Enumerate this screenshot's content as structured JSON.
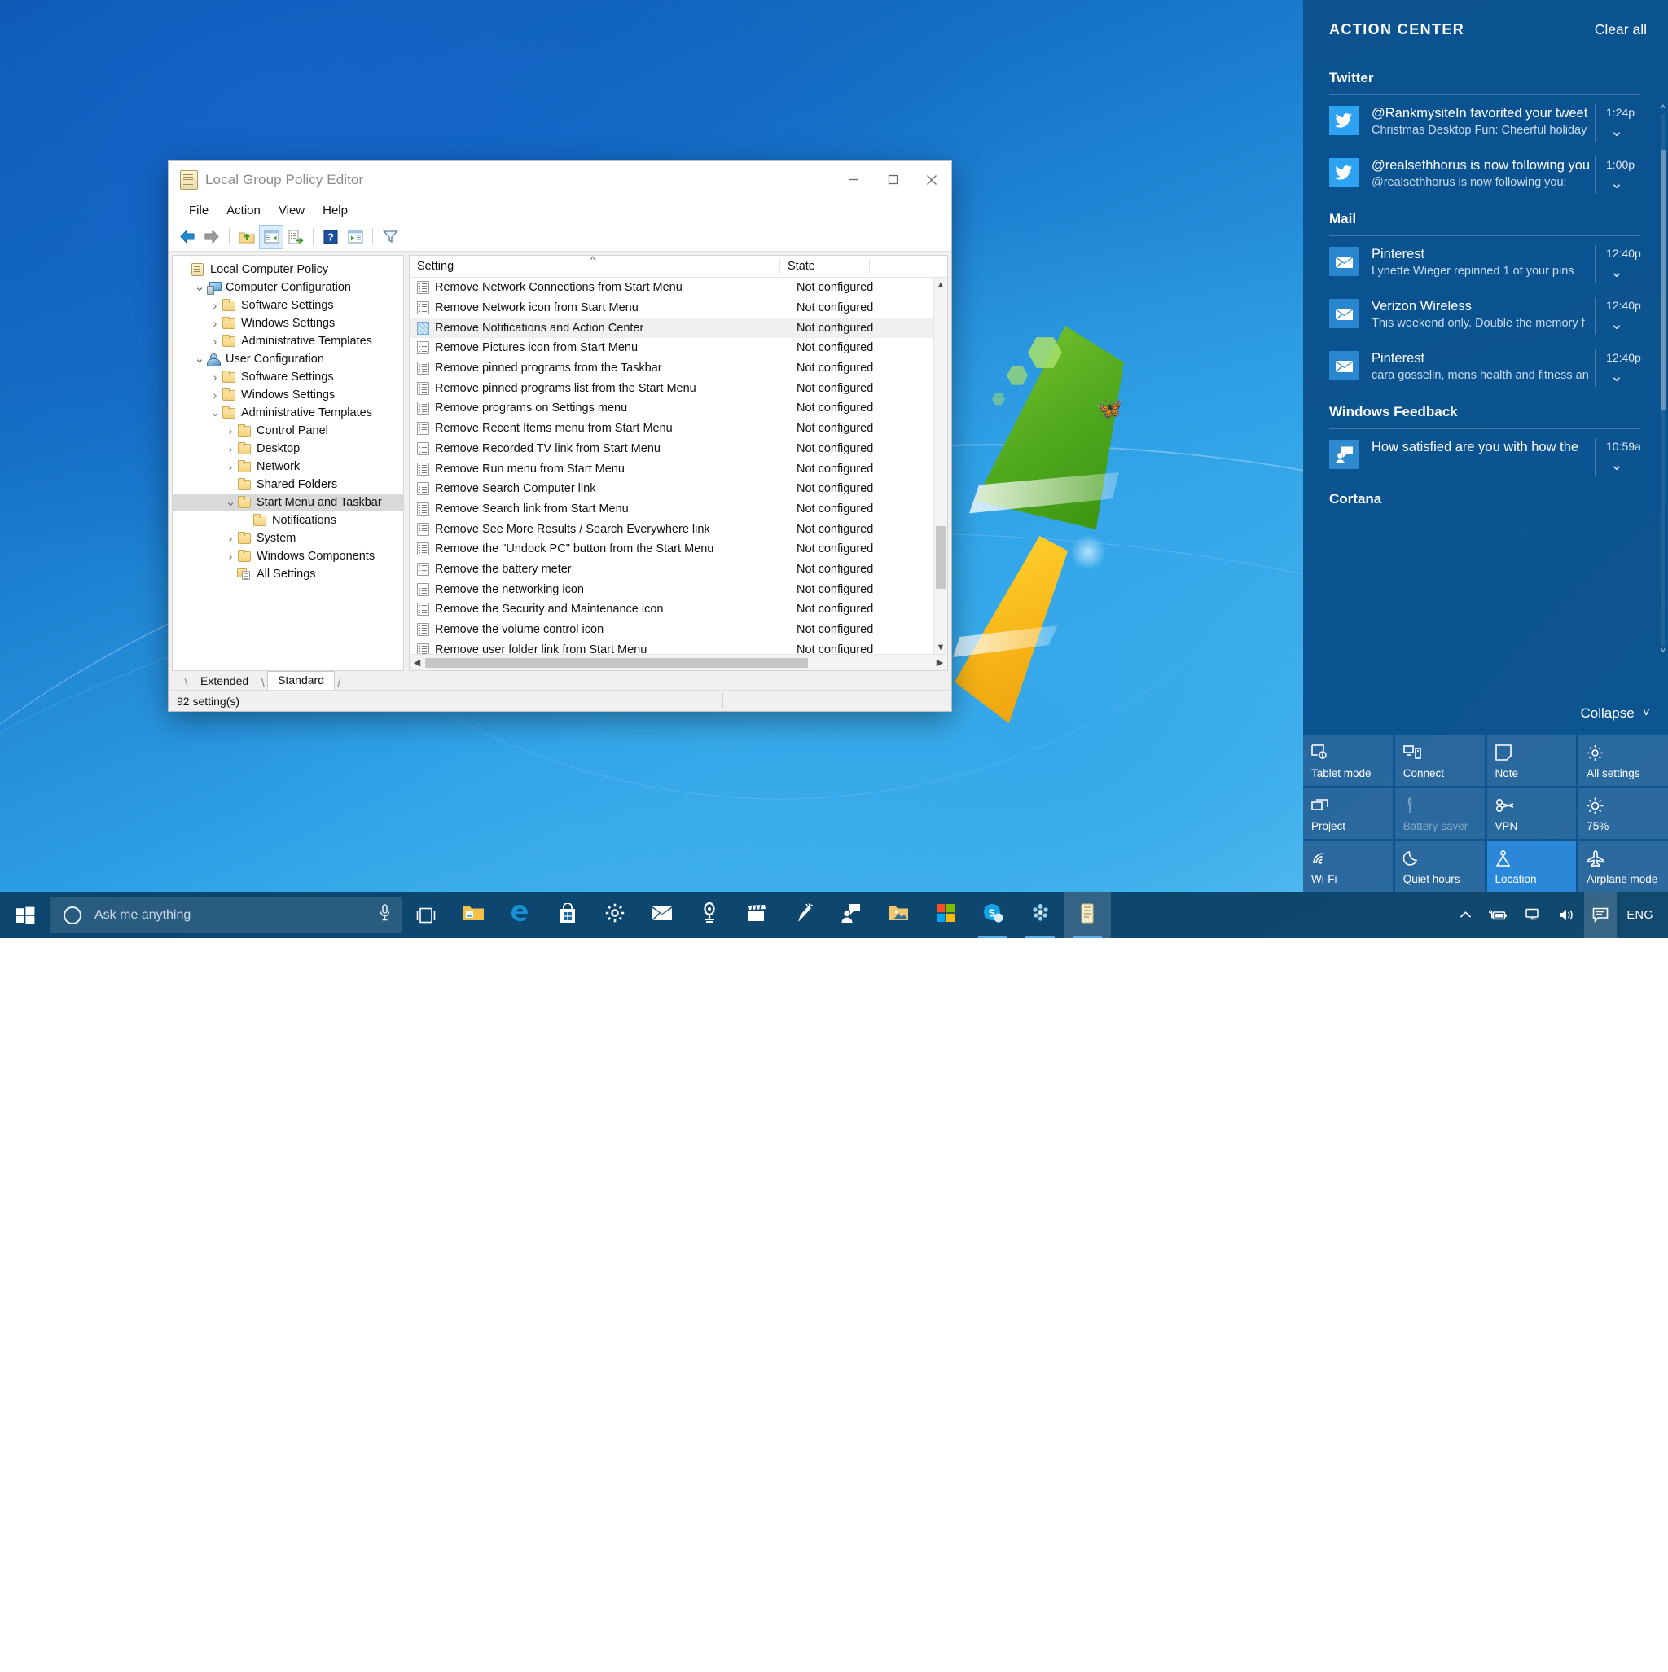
{
  "window": {
    "title": "Local Group Policy Editor",
    "title_icon": "policy-scroll-icon",
    "controls": {
      "minimize": "minimize-icon",
      "maximize": "maximize-icon",
      "close": "close-icon"
    },
    "menu": [
      "File",
      "Action",
      "View",
      "Help"
    ],
    "toolbar": [
      {
        "name": "back-button",
        "icon": "arrow-left-icon",
        "active": false
      },
      {
        "name": "forward-button",
        "icon": "arrow-right-icon",
        "active": false
      },
      {
        "name": "up-one-level-button",
        "icon": "folder-up-icon",
        "active": false
      },
      {
        "name": "show-hide-console-tree-button",
        "icon": "console-tree-icon",
        "active": true
      },
      {
        "name": "export-list-button",
        "icon": "export-list-icon",
        "active": false
      },
      {
        "name": "help-button",
        "icon": "help-question-icon",
        "active": false
      },
      {
        "name": "show-hide-action-pane-button",
        "icon": "action-pane-icon",
        "active": false
      },
      {
        "name": "filter-button",
        "icon": "funnel-filter-icon",
        "active": false
      }
    ],
    "tree": [
      {
        "label": "Local Computer Policy",
        "indent": 0,
        "chevron": "none",
        "icon": "policy-scroll-icon",
        "selected": false
      },
      {
        "label": "Computer Configuration",
        "indent": 1,
        "chevron": "down",
        "icon": "computer-icon",
        "selected": false
      },
      {
        "label": "Software Settings",
        "indent": 2,
        "chevron": "right",
        "icon": "folder-icon",
        "selected": false
      },
      {
        "label": "Windows Settings",
        "indent": 2,
        "chevron": "right",
        "icon": "folder-icon",
        "selected": false
      },
      {
        "label": "Administrative Templates",
        "indent": 2,
        "chevron": "right",
        "icon": "folder-icon",
        "selected": false
      },
      {
        "label": "User Configuration",
        "indent": 1,
        "chevron": "down",
        "icon": "user-icon",
        "selected": false
      },
      {
        "label": "Software Settings",
        "indent": 2,
        "chevron": "right",
        "icon": "folder-icon",
        "selected": false
      },
      {
        "label": "Windows Settings",
        "indent": 2,
        "chevron": "right",
        "icon": "folder-icon",
        "selected": false
      },
      {
        "label": "Administrative Templates",
        "indent": 2,
        "chevron": "down",
        "icon": "folder-icon",
        "selected": false
      },
      {
        "label": "Control Panel",
        "indent": 3,
        "chevron": "right",
        "icon": "folder-icon",
        "selected": false
      },
      {
        "label": "Desktop",
        "indent": 3,
        "chevron": "right",
        "icon": "folder-icon",
        "selected": false
      },
      {
        "label": "Network",
        "indent": 3,
        "chevron": "right",
        "icon": "folder-icon",
        "selected": false
      },
      {
        "label": "Shared Folders",
        "indent": 3,
        "chevron": "none",
        "icon": "folder-icon",
        "selected": false
      },
      {
        "label": "Start Menu and Taskbar",
        "indent": 3,
        "chevron": "down",
        "icon": "folder-icon",
        "selected": true
      },
      {
        "label": "Notifications",
        "indent": 4,
        "chevron": "none",
        "icon": "folder-icon",
        "selected": false
      },
      {
        "label": "System",
        "indent": 3,
        "chevron": "right",
        "icon": "folder-icon",
        "selected": false
      },
      {
        "label": "Windows Components",
        "indent": 3,
        "chevron": "right",
        "icon": "folder-icon",
        "selected": false
      },
      {
        "label": "All Settings",
        "indent": 3,
        "chevron": "none",
        "icon": "all-settings-icon",
        "selected": false
      }
    ],
    "list": {
      "columns": [
        "Setting",
        "State"
      ],
      "sort_indicator": "ascending-caret-icon",
      "rows": [
        {
          "setting": "Remove Network Connections from Start Menu",
          "state": "Not configured",
          "selected": false
        },
        {
          "setting": "Remove Network icon from Start Menu",
          "state": "Not configured",
          "selected": false
        },
        {
          "setting": "Remove Notifications and Action Center",
          "state": "Not configured",
          "selected": true
        },
        {
          "setting": "Remove Pictures icon from Start Menu",
          "state": "Not configured",
          "selected": false
        },
        {
          "setting": "Remove pinned programs from the Taskbar",
          "state": "Not configured",
          "selected": false
        },
        {
          "setting": "Remove pinned programs list from the Start Menu",
          "state": "Not configured",
          "selected": false
        },
        {
          "setting": "Remove programs on Settings menu",
          "state": "Not configured",
          "selected": false
        },
        {
          "setting": "Remove Recent Items menu from Start Menu",
          "state": "Not configured",
          "selected": false
        },
        {
          "setting": "Remove Recorded TV link from Start Menu",
          "state": "Not configured",
          "selected": false
        },
        {
          "setting": "Remove Run menu from Start Menu",
          "state": "Not configured",
          "selected": false
        },
        {
          "setting": "Remove Search Computer link",
          "state": "Not configured",
          "selected": false
        },
        {
          "setting": "Remove Search link from Start Menu",
          "state": "Not configured",
          "selected": false
        },
        {
          "setting": "Remove See More Results / Search Everywhere link",
          "state": "Not configured",
          "selected": false
        },
        {
          "setting": "Remove the \"Undock PC\" button from the Start Menu",
          "state": "Not configured",
          "selected": false
        },
        {
          "setting": "Remove the battery meter",
          "state": "Not configured",
          "selected": false
        },
        {
          "setting": "Remove the networking icon",
          "state": "Not configured",
          "selected": false
        },
        {
          "setting": "Remove the Security and Maintenance icon",
          "state": "Not configured",
          "selected": false
        },
        {
          "setting": "Remove the volume control icon",
          "state": "Not configured",
          "selected": false
        },
        {
          "setting": "Remove user folder link from Start Menu",
          "state": "Not configured",
          "selected": false
        }
      ]
    },
    "tabs": [
      {
        "label": "Extended",
        "active": false
      },
      {
        "label": "Standard",
        "active": true
      }
    ],
    "statusbar": {
      "count": "92 setting(s)",
      "cell2": "",
      "cell3": ""
    }
  },
  "action_center": {
    "title": "ACTION CENTER",
    "clear_all": "Clear all",
    "collapse": "Collapse",
    "groups": [
      {
        "name": "Twitter",
        "items": [
          {
            "icon": "twitter-icon",
            "title": "@RankmysiteIn favorited your tweet",
            "body": "Christmas Desktop Fun: Cheerful holiday",
            "time": "1:24p"
          },
          {
            "icon": "twitter-icon",
            "title": "@realsethhorus is now following you",
            "body": "@realsethhorus is now following you!",
            "time": "1:00p"
          }
        ]
      },
      {
        "name": "Mail",
        "items": [
          {
            "icon": "mail-icon",
            "title": "Pinterest",
            "body": "Lynette Wieger repinned 1 of your pins",
            "time": "12:40p"
          },
          {
            "icon": "mail-icon",
            "title": "Verizon Wireless",
            "body": "This weekend only. Double the memory f",
            "time": "12:40p"
          },
          {
            "icon": "mail-icon",
            "title": "Pinterest",
            "body": "cara gosselin, mens health and fitness an",
            "time": "12:40p"
          }
        ]
      },
      {
        "name": "Windows Feedback",
        "items": [
          {
            "icon": "feedback-icon",
            "title": "How satisfied are you with how the",
            "body": "",
            "time": "10:59a"
          }
        ]
      },
      {
        "name": "Cortana",
        "items": []
      }
    ],
    "tiles": [
      {
        "label": "Tablet mode",
        "icon": "tablet-mode-icon",
        "state": "off"
      },
      {
        "label": "Connect",
        "icon": "connect-icon",
        "state": "off"
      },
      {
        "label": "Note",
        "icon": "note-icon",
        "state": "off"
      },
      {
        "label": "All settings",
        "icon": "gear-icon",
        "state": "off"
      },
      {
        "label": "Project",
        "icon": "project-icon",
        "state": "off"
      },
      {
        "label": "Battery saver",
        "icon": "battery-saver-icon",
        "state": "disabled"
      },
      {
        "label": "VPN",
        "icon": "vpn-icon",
        "state": "off"
      },
      {
        "label": "75%",
        "icon": "brightness-icon",
        "state": "off"
      },
      {
        "label": "Wi-Fi",
        "icon": "wifi-icon",
        "state": "off"
      },
      {
        "label": "Quiet hours",
        "icon": "moon-icon",
        "state": "off"
      },
      {
        "label": "Location",
        "icon": "location-icon",
        "state": "on"
      },
      {
        "label": "Airplane mode",
        "icon": "airplane-icon",
        "state": "off"
      }
    ]
  },
  "taskbar": {
    "start": "windows-logo-icon",
    "search_placeholder": "Ask me anything",
    "cortana_icon": "cortana-circle-icon",
    "mic_icon": "microphone-icon",
    "taskview_icon": "task-view-icon",
    "apps": [
      {
        "name": "file-explorer",
        "icon": "folder-icon",
        "running": false,
        "active": false
      },
      {
        "name": "microsoft-edge",
        "icon": "edge-icon",
        "running": false,
        "active": false
      },
      {
        "name": "store",
        "icon": "store-bag-icon",
        "running": false,
        "active": false
      },
      {
        "name": "settings",
        "icon": "gear-icon",
        "running": false,
        "active": false
      },
      {
        "name": "mail",
        "icon": "envelope-icon",
        "running": false,
        "active": false
      },
      {
        "name": "maps",
        "icon": "map-pin-icon",
        "running": false,
        "active": false
      },
      {
        "name": "movies-and-tv",
        "icon": "clapperboard-icon",
        "running": false,
        "active": false
      },
      {
        "name": "sketch",
        "icon": "pencil-icon",
        "running": false,
        "active": false
      },
      {
        "name": "feedback-hub",
        "icon": "person-chat-icon",
        "running": false,
        "active": false
      },
      {
        "name": "documents-folder",
        "icon": "folder-photo-icon",
        "running": false,
        "active": false
      },
      {
        "name": "office",
        "icon": "office-squares-icon",
        "running": false,
        "active": false
      },
      {
        "name": "skype",
        "icon": "skype-icon",
        "running": true,
        "active": false
      },
      {
        "name": "photos",
        "icon": "photos-icon",
        "running": true,
        "active": false
      },
      {
        "name": "group-policy-editor",
        "icon": "policy-scroll-icon",
        "running": true,
        "active": true
      }
    ],
    "tray": [
      {
        "name": "show-hidden-icons",
        "icon": "chevron-up-icon"
      },
      {
        "name": "power",
        "icon": "battery-plug-icon"
      },
      {
        "name": "network",
        "icon": "network-monitor-icon"
      },
      {
        "name": "volume",
        "icon": "speaker-icon"
      },
      {
        "name": "action-center",
        "icon": "action-center-icon",
        "active": true
      }
    ],
    "language": "ENG"
  }
}
